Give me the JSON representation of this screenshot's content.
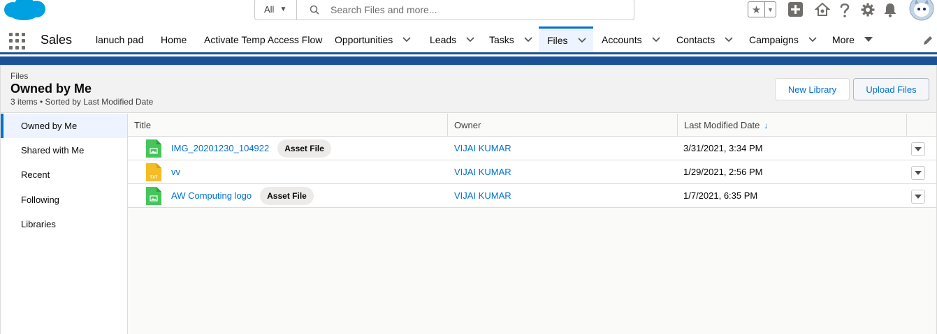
{
  "header": {
    "search_scope": "All",
    "search_placeholder": "Search Files and more...",
    "icons": [
      "favorites-star-icon",
      "add-icon",
      "trailhead-icon",
      "help-icon",
      "setup-gear-icon",
      "notifications-bell-icon",
      "avatar"
    ]
  },
  "nav": {
    "app_name": "Sales",
    "items": [
      {
        "label": "lanuch pad",
        "has_menu": false
      },
      {
        "label": "Home",
        "has_menu": false
      },
      {
        "label": "Activate Temp Access Flow",
        "has_menu": false
      },
      {
        "label": "Opportunities",
        "has_menu": true
      },
      {
        "label": "Leads",
        "has_menu": true
      },
      {
        "label": "Tasks",
        "has_menu": true
      },
      {
        "label": "Files",
        "has_menu": true,
        "active": true
      },
      {
        "label": "Accounts",
        "has_menu": true
      },
      {
        "label": "Contacts",
        "has_menu": true
      },
      {
        "label": "Campaigns",
        "has_menu": true
      },
      {
        "label": "More",
        "has_menu": true
      }
    ]
  },
  "list": {
    "object_name": "Files",
    "title": "Owned by Me",
    "meta": "3 items • Sorted by Last Modified Date",
    "buttons": {
      "new_library": "New Library",
      "upload_files": "Upload Files"
    }
  },
  "sidebar": {
    "items": [
      {
        "label": "Owned by Me",
        "active": true
      },
      {
        "label": "Shared with Me"
      },
      {
        "label": "Recent"
      },
      {
        "label": "Following"
      },
      {
        "label": "Libraries"
      }
    ]
  },
  "table": {
    "columns": [
      "Title",
      "Owner",
      "Last Modified Date"
    ],
    "sort_column": "Last Modified Date",
    "rows": [
      {
        "title": "IMG_20201230_104922",
        "badge": "Asset File",
        "file_type": "image",
        "owner": "VIJAI KUMAR",
        "modified": "3/31/2021, 3:34 PM"
      },
      {
        "title": "vv",
        "badge": "",
        "file_type": "txt",
        "file_type_label": "TXT",
        "owner": "VIJAI KUMAR",
        "modified": "1/29/2021, 2:56 PM"
      },
      {
        "title": "AW Computing logo",
        "badge": "Asset File",
        "file_type": "image",
        "owner": "VIJAI KUMAR",
        "modified": "1/7/2021, 6:35 PM"
      }
    ]
  },
  "colors": {
    "brand_blue": "#0070d2",
    "nav_bar": "#1b5297",
    "image_file": "#45c65a",
    "txt_file": "#f4bc25",
    "salesforce_cloud": "#00a1e0"
  }
}
